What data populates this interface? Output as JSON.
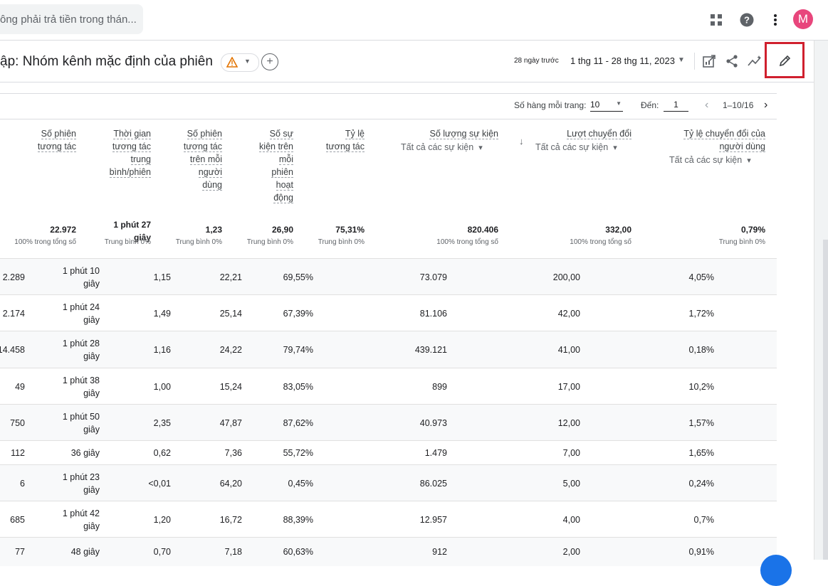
{
  "topbar": {
    "search_text": "ông phải trả tiền trong thán...",
    "avatar_letter": "M"
  },
  "report": {
    "title": "ập: Nhóm kênh mặc định của phiên",
    "date_prefix": "28 ngày trước",
    "date_range": "1 thg 11 - 28 thg 11, 2023"
  },
  "pager": {
    "rows_label": "Số hàng mỗi trang:",
    "rows_value": "10",
    "goto_label": "Đến:",
    "goto_value": "1",
    "range": "1–10/16"
  },
  "columns": [
    {
      "lines": [
        "Số phiên",
        "tương tác"
      ]
    },
    {
      "lines": [
        "Thời gian",
        "tương tác",
        "trung",
        "bình/phiên"
      ]
    },
    {
      "lines": [
        "Số phiên",
        "tương tác",
        "trên mỗi",
        "người",
        "dùng"
      ]
    },
    {
      "lines": [
        "Số sự",
        "kiện trên",
        "mỗi",
        "phiên",
        "hoạt",
        "động"
      ]
    },
    {
      "lines": [
        "Tỷ lệ",
        "tương tác"
      ]
    },
    {
      "lines": [
        "Số lượng sự kiện"
      ],
      "sub": "Tất cả các sự kiện"
    },
    {
      "lines": [
        "Lượt chuyển đổi"
      ],
      "sub": "Tất cả các sự kiện"
    },
    {
      "lines": [
        "Tỷ lệ chuyển đổi của",
        "người dùng"
      ],
      "sub": "Tất cả các sự kiện"
    }
  ],
  "totals": [
    {
      "value": "22.972",
      "sub": "100% trong tổng số"
    },
    {
      "value": [
        "1 phút 27",
        "giây"
      ],
      "sub": "Trung bình 0%"
    },
    {
      "value": "1,23",
      "sub": "Trung bình 0%"
    },
    {
      "value": "26,90",
      "sub": "Trung bình 0%"
    },
    {
      "value": "75,31%",
      "sub": "Trung bình 0%"
    },
    {
      "value": "820.406",
      "sub": "100% trong tổng số"
    },
    {
      "value": "332,00",
      "sub": "100% trong tổng số"
    },
    {
      "value": "0,79%",
      "sub": "Trung bình 0%"
    }
  ],
  "rows": [
    [
      "2.289",
      [
        "1 phút 10",
        "giây"
      ],
      "1,15",
      "22,21",
      "69,55%",
      "73.079",
      "200,00",
      "4,05%"
    ],
    [
      "2.174",
      [
        "1 phút 24",
        "giây"
      ],
      "1,49",
      "25,14",
      "67,39%",
      "81.106",
      "42,00",
      "1,72%"
    ],
    [
      "14.458",
      [
        "1 phút 28",
        "giây"
      ],
      "1,16",
      "24,22",
      "79,74%",
      "439.121",
      "41,00",
      "0,18%"
    ],
    [
      "49",
      [
        "1 phút 38",
        "giây"
      ],
      "1,00",
      "15,24",
      "83,05%",
      "899",
      "17,00",
      "10,2%"
    ],
    [
      "750",
      [
        "1 phút 50",
        "giây"
      ],
      "2,35",
      "47,87",
      "87,62%",
      "40.973",
      "12,00",
      "1,57%"
    ],
    [
      "112",
      [
        "36 giây"
      ],
      "0,62",
      "7,36",
      "55,72%",
      "1.479",
      "7,00",
      "1,65%"
    ],
    [
      "6",
      [
        "1 phút 23",
        "giây"
      ],
      "<0,01",
      "64,20",
      "0,45%",
      "86.025",
      "5,00",
      "0,24%"
    ],
    [
      "685",
      [
        "1 phút 42",
        "giây"
      ],
      "1,20",
      "16,72",
      "88,39%",
      "12.957",
      "4,00",
      "0,7%"
    ],
    [
      "77",
      [
        "48 giây"
      ],
      "0,70",
      "7,18",
      "60,63%",
      "912",
      "2,00",
      "0,91%"
    ]
  ]
}
